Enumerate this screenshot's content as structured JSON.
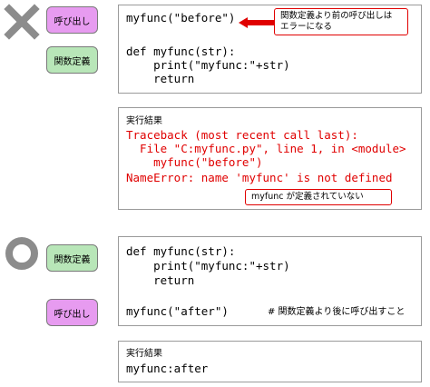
{
  "panel_bad": {
    "mark_icon": "cross-mark-icon",
    "tag_call": "呼び出し",
    "tag_def": "関数定義",
    "code_lines": [
      "myfunc(\"before\")",
      "",
      "def myfunc(str):",
      "    print(\"myfunc:\"+str)",
      "    return"
    ],
    "callout_line1": "関数定義より前の呼び出しは",
    "callout_line2": "エラーになる",
    "result_label": "実行結果",
    "result_lines": [
      "Traceback (most recent call last):",
      "  File \"C:myfunc.py\", line 1, in <module>",
      "    myfunc(\"before\")",
      "NameError: name 'myfunc' is not defined"
    ],
    "error_note": "myfunc が定義されていない"
  },
  "panel_good": {
    "mark_icon": "circle-mark-icon",
    "tag_def": "関数定義",
    "tag_call": "呼び出し",
    "code_lines": [
      "def myfunc(str):",
      "    print(\"myfunc:\"+str)",
      "    return"
    ],
    "call_line": "myfunc(\"after\")",
    "comment": "# 関数定義より後に呼び出すこと",
    "result_label": "実行結果",
    "result_line": "myfunc:after"
  },
  "colors": {
    "call_tag": "#e79bf0",
    "def_tag": "#b8e6b8",
    "error": "#e00000",
    "mark": "#8c8c8c"
  }
}
